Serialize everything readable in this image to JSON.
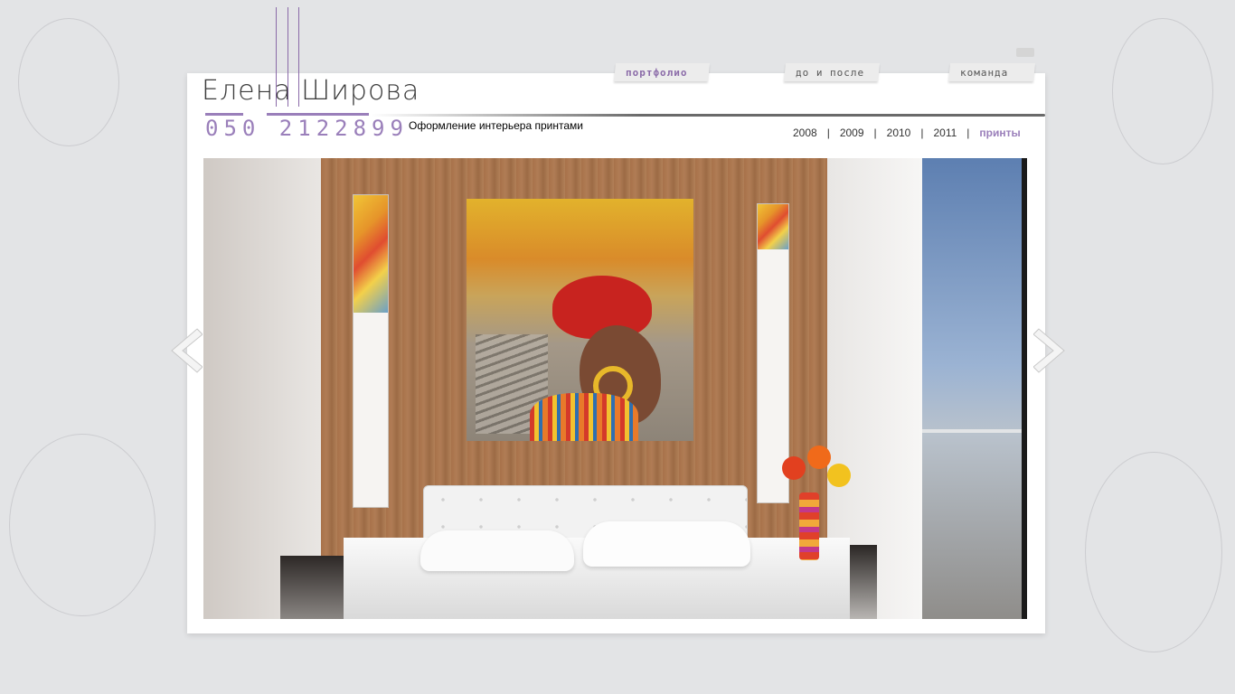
{
  "brand": {
    "name": "Елена Широва",
    "phone": "050 2122899"
  },
  "nav": {
    "tabs": [
      {
        "label": "портфолио",
        "active": true
      },
      {
        "label": "до и после",
        "active": false
      },
      {
        "label": "команда",
        "active": false
      }
    ]
  },
  "page": {
    "subtitle": "Оформление интерьера принтами"
  },
  "years": {
    "items": [
      {
        "label": "2008",
        "active": false
      },
      {
        "label": "2009",
        "active": false
      },
      {
        "label": "2010",
        "active": false
      },
      {
        "label": "2011",
        "active": false
      },
      {
        "label": "принты",
        "active": true
      }
    ],
    "separator": "|"
  },
  "colors": {
    "accent": "#9a7fba",
    "background": "#e3e4e6",
    "card": "#ffffff"
  },
  "icons": {
    "prev": "chevron-left-icon",
    "next": "chevron-right-icon"
  }
}
